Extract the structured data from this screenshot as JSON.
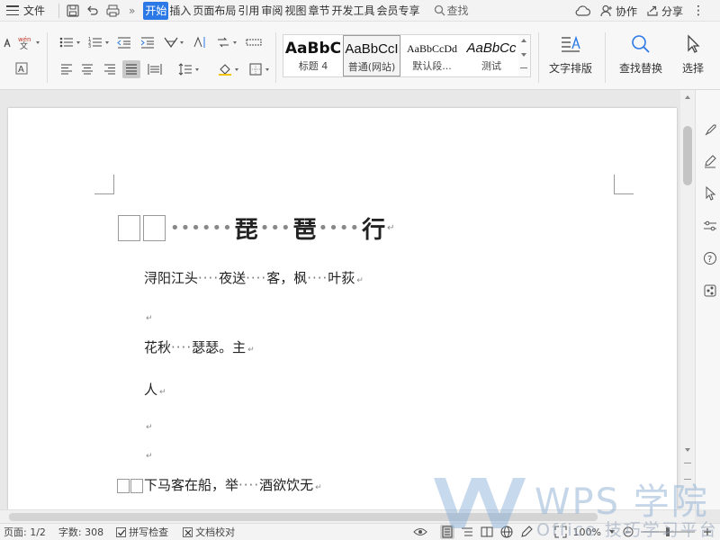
{
  "menubar": {
    "file": "文件",
    "tabs": [
      "开始",
      "插入",
      "页面布局",
      "引用",
      "审阅",
      "视图",
      "章节",
      "开发工具",
      "会员专享"
    ],
    "active_tab": "开始",
    "search": "查找",
    "more": "»",
    "collab": "协作",
    "share": "分享"
  },
  "ribbon": {
    "styles": [
      {
        "sample": "AaBbC",
        "label": "标题 4"
      },
      {
        "sample": "AaBbCcI",
        "label": "普通(网站)"
      },
      {
        "sample": "AaBbCcDd",
        "label": "默认段..."
      },
      {
        "sample": "AaBbCc",
        "label": "测试"
      }
    ],
    "text_layout": "文字排版",
    "find_replace": "查找替换",
    "select": "选择"
  },
  "document": {
    "title_chars": [
      "琵",
      "琶",
      "行"
    ],
    "title_dots": [
      "••••••",
      "•••",
      "••••"
    ],
    "lines": [
      {
        "parts": [
          "浔阳江头",
          "····",
          "夜送",
          "····",
          "客，枫",
          "····",
          "叶荻"
        ]
      },
      {
        "parts": [
          "花秋",
          "····",
          "瑟瑟。主"
        ]
      },
      {
        "parts": [
          "人"
        ]
      },
      {
        "parts": [
          "下马客在船，举",
          "····",
          "酒欲饮无"
        ]
      }
    ],
    "paragraph_mark": "↵"
  },
  "statusbar": {
    "page": "页面: 1/2",
    "words": "字数: 308",
    "spell": "拼写检查",
    "proof": "文档校对",
    "zoom": "100%"
  },
  "watermark": {
    "brand": "WPS 学院",
    "subtitle": "Office 技巧学习平台"
  }
}
